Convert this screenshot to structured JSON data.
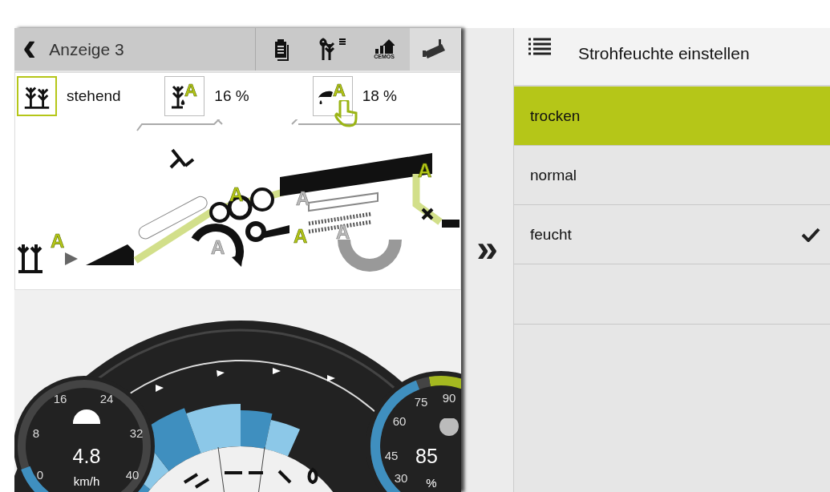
{
  "header": {
    "back": "‹",
    "title": "Anzeige 3",
    "toolbar": [
      {
        "kind": "clipboard"
      },
      {
        "kind": "crops"
      },
      {
        "kind": "cemos",
        "label": "CEMOS"
      },
      {
        "kind": "camera"
      }
    ]
  },
  "status": [
    {
      "kind": "crop",
      "text": "stehend",
      "highlighted": true,
      "hand": false
    },
    {
      "kind": "moisture",
      "text": "16 %",
      "marker": "A",
      "highlighted": false,
      "hand": false
    },
    {
      "kind": "straw",
      "text": "18 %",
      "marker": "A",
      "highlighted": false,
      "hand": true
    }
  ],
  "diagram": {
    "markers": [
      {
        "text": "A",
        "active": true
      },
      {
        "text": "A",
        "active": true
      },
      {
        "text": "A",
        "active": false
      },
      {
        "text": "A",
        "active": true
      },
      {
        "text": "A",
        "active": false
      },
      {
        "text": "A",
        "active": false
      },
      {
        "text": "A",
        "active": true
      }
    ]
  },
  "speed_gauge": {
    "ticks": [
      "0",
      "8",
      "16",
      "24",
      "32",
      "40"
    ],
    "value": "4.8",
    "unit": "km/h",
    "level": 0.12
  },
  "load_gauge": {
    "ticks": [
      "30",
      "45",
      "60",
      "75",
      "90"
    ],
    "value": "85",
    "unit": "%",
    "level": 0.92
  },
  "collapse": "»",
  "panel": {
    "title": "Strohfeuchte einstellen",
    "options": [
      {
        "label": "trocken",
        "highlighted": true,
        "selected": false
      },
      {
        "label": "normal",
        "highlighted": false,
        "selected": false
      },
      {
        "label": "feucht",
        "highlighted": false,
        "selected": true
      }
    ]
  }
}
